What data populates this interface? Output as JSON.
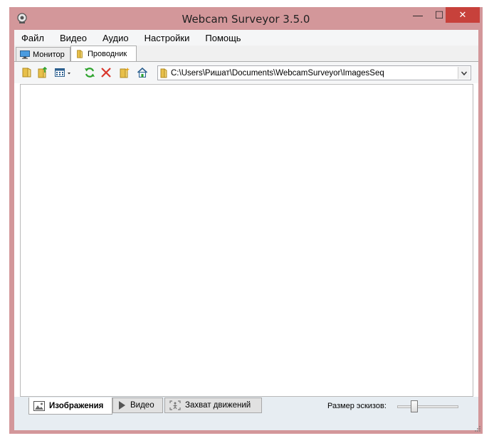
{
  "window": {
    "title": "Webcam Surveyor 3.5.0",
    "minimize_glyph": "—",
    "maximize_glyph": "☐",
    "close_glyph": "✕"
  },
  "menu": [
    {
      "label": "Файл"
    },
    {
      "label": "Видео"
    },
    {
      "label": "Аудио"
    },
    {
      "label": "Настройки"
    },
    {
      "label": "Помощь"
    }
  ],
  "top_tabs": [
    {
      "label": "Монитор",
      "icon": "monitor-icon",
      "active": false
    },
    {
      "label": "Проводник",
      "icon": "folder-icon",
      "active": true
    }
  ],
  "toolbar": {
    "buttons": [
      {
        "icon": "open-folder-icon"
      },
      {
        "icon": "folder-up-icon"
      },
      {
        "icon": "view-mode-icon"
      },
      {
        "icon": "refresh-icon"
      },
      {
        "icon": "delete-icon"
      },
      {
        "icon": "new-folder-icon"
      },
      {
        "icon": "home-icon"
      }
    ],
    "path_value": "C:\\Users\\Ришат\\Documents\\WebcamSurveyor\\ImagesSeq",
    "dropdown_glyph": "⌄"
  },
  "bottom_tabs": [
    {
      "label": "Изображения",
      "icon": "image-icon",
      "active": true
    },
    {
      "label": "Видео",
      "icon": "play-icon",
      "active": false
    },
    {
      "label": "Захват движений",
      "icon": "motion-icon",
      "active": false
    }
  ],
  "thumbnail_size": {
    "label": "Размер эскизов:",
    "value_fraction": 0.25
  },
  "colors": {
    "frame": "#d3979a",
    "close": "#c7413b",
    "refresh": "#2ea32e",
    "delete": "#d9362b",
    "folder": "#e8c04a"
  }
}
